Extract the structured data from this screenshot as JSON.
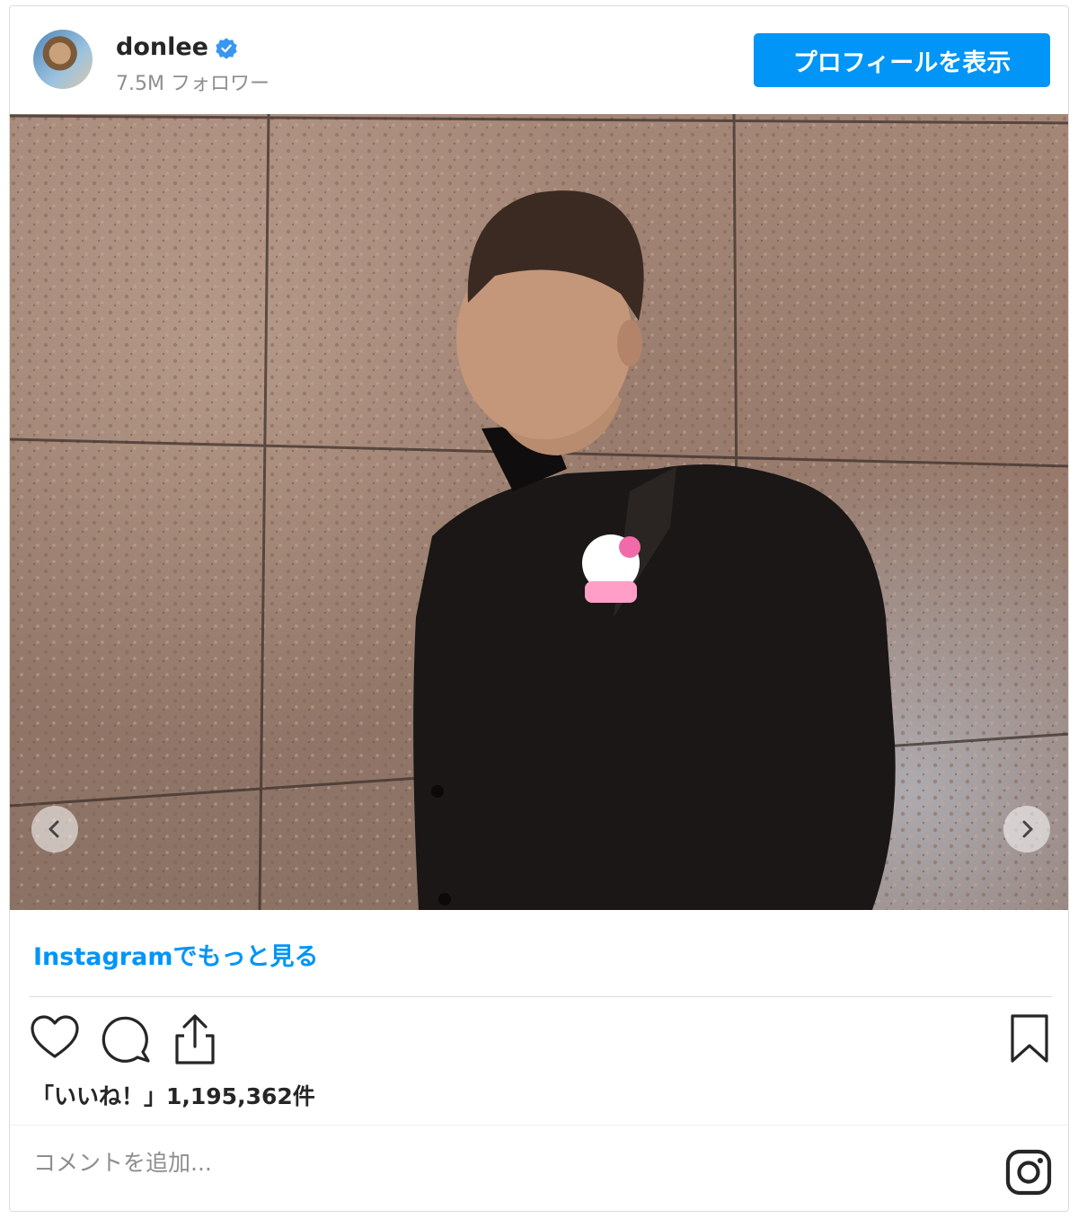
{
  "header": {
    "username": "donlee",
    "followers": "7.5M フォロワー",
    "profile_button": "プロフィールを表示",
    "verified_icon": "verified-badge-icon",
    "verified_color": "#3897f0"
  },
  "post": {
    "image_alt": "donlee Instagram photo",
    "prev_icon": "chevron-left-icon",
    "next_icon": "chevron-right-icon"
  },
  "more_link": "Instagramでもっと見る",
  "actions": {
    "like_icon": "heart-icon",
    "comment_icon": "comment-bubble-icon",
    "share_icon": "share-icon",
    "save_icon": "bookmark-icon"
  },
  "likes": "「いいね！」1,195,362件",
  "comment": {
    "placeholder": "コメントを追加..."
  },
  "footer_icon": "instagram-logo-icon",
  "colors": {
    "accent": "#0095f6",
    "text": "#262626",
    "muted": "#8e8e8e",
    "border": "#dbdbdb"
  }
}
